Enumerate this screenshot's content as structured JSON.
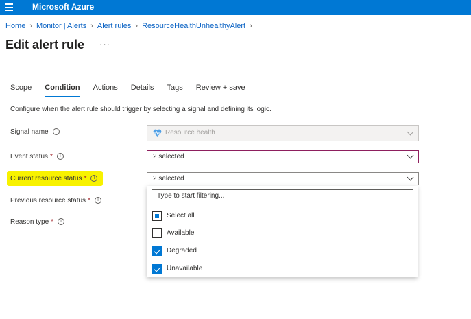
{
  "header": {
    "brand": "Microsoft Azure"
  },
  "breadcrumb": [
    "Home",
    "Monitor | Alerts",
    "Alert rules",
    "ResourceHealthUnhealthyAlert"
  ],
  "page": {
    "title": "Edit alert rule",
    "more": "···"
  },
  "tabs": [
    "Scope",
    "Condition",
    "Actions",
    "Details",
    "Tags",
    "Review + save"
  ],
  "active_tab": "Condition",
  "description": "Configure when the alert rule should trigger by selecting a signal and defining its logic.",
  "fields": {
    "signal_name": {
      "label": "Signal name",
      "value": "Resource health"
    },
    "event_status": {
      "label": "Event status",
      "value": "2 selected"
    },
    "current_resource_status": {
      "label": "Current resource status",
      "value": "2 selected"
    },
    "previous_resource_status": {
      "label": "Previous resource status"
    },
    "reason_type": {
      "label": "Reason type"
    },
    "required_mark": "*"
  },
  "dropdown": {
    "filter_placeholder": "Type to start filtering...",
    "options": [
      {
        "label": "Select all",
        "state": "indeterminate"
      },
      {
        "label": "Available",
        "state": "unchecked"
      },
      {
        "label": "Degraded",
        "state": "checked"
      },
      {
        "label": "Unavailable",
        "state": "checked"
      }
    ]
  },
  "colors": {
    "accent": "#0078d4",
    "highlight": "#f8f200"
  },
  "icons": {
    "info": "info-icon",
    "menu": "hamburger-icon",
    "signal": "heart-pulse-icon"
  }
}
